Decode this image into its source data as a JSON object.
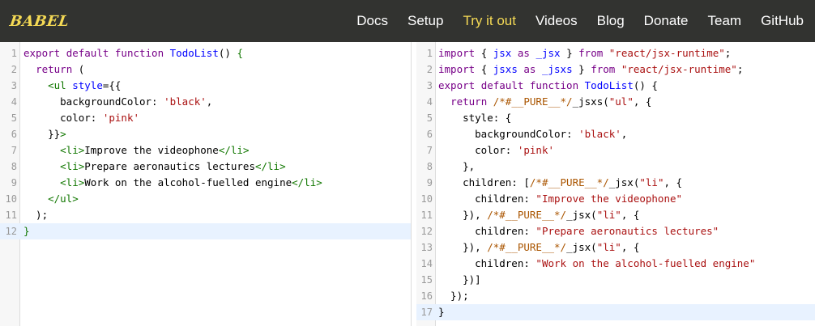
{
  "nav": {
    "logo": "BABEL",
    "links": [
      "Docs",
      "Setup",
      "Try it out",
      "Videos",
      "Blog",
      "Donate",
      "Team",
      "GitHub"
    ],
    "active": "Try it out"
  },
  "input_editor": {
    "lines": [
      [
        [
          "k",
          "export "
        ],
        [
          "k",
          "default "
        ],
        [
          "k",
          "function "
        ],
        [
          "f",
          "TodoList"
        ],
        [
          "pl",
          "() "
        ],
        [
          "t",
          "{"
        ]
      ],
      [
        [
          "pl",
          "  "
        ],
        [
          "k",
          "return "
        ],
        [
          "pl",
          "("
        ]
      ],
      [
        [
          "pl",
          "    "
        ],
        [
          "t",
          "<ul "
        ],
        [
          "f",
          "style"
        ],
        [
          "pl",
          "={{"
        ]
      ],
      [
        [
          "pl",
          "      backgroundColor: "
        ],
        [
          "s",
          "'black'"
        ],
        [
          "pl",
          ","
        ]
      ],
      [
        [
          "pl",
          "      color: "
        ],
        [
          "s",
          "'pink'"
        ]
      ],
      [
        [
          "pl",
          "    }}"
        ],
        [
          "t",
          ">"
        ]
      ],
      [
        [
          "pl",
          "      "
        ],
        [
          "t",
          "<li>"
        ],
        [
          "pl",
          "Improve the videophone"
        ],
        [
          "t",
          "</li>"
        ]
      ],
      [
        [
          "pl",
          "      "
        ],
        [
          "t",
          "<li>"
        ],
        [
          "pl",
          "Prepare aeronautics lectures"
        ],
        [
          "t",
          "</li>"
        ]
      ],
      [
        [
          "pl",
          "      "
        ],
        [
          "t",
          "<li>"
        ],
        [
          "pl",
          "Work on the alcohol-fuelled engine"
        ],
        [
          "t",
          "</li>"
        ]
      ],
      [
        [
          "pl",
          "    "
        ],
        [
          "t",
          "</ul>"
        ]
      ],
      [
        [
          "pl",
          "  );"
        ]
      ],
      [
        [
          "t",
          "}"
        ]
      ]
    ],
    "current_line": 12
  },
  "output_editor": {
    "lines": [
      [
        [
          "k",
          "import "
        ],
        [
          "pl",
          "{ "
        ],
        [
          "f",
          "jsx "
        ],
        [
          "k",
          "as "
        ],
        [
          "f",
          "_jsx "
        ],
        [
          "pl",
          "} "
        ],
        [
          "k",
          "from "
        ],
        [
          "s",
          "\"react/jsx-runtime\""
        ],
        [
          "pl",
          ";"
        ]
      ],
      [
        [
          "k",
          "import "
        ],
        [
          "pl",
          "{ "
        ],
        [
          "f",
          "jsxs "
        ],
        [
          "k",
          "as "
        ],
        [
          "f",
          "_jsxs "
        ],
        [
          "pl",
          "} "
        ],
        [
          "k",
          "from "
        ],
        [
          "s",
          "\"react/jsx-runtime\""
        ],
        [
          "pl",
          ";"
        ]
      ],
      [
        [
          "k",
          "export "
        ],
        [
          "k",
          "default "
        ],
        [
          "k",
          "function "
        ],
        [
          "f",
          "TodoList"
        ],
        [
          "pl",
          "() {"
        ]
      ],
      [
        [
          "pl",
          "  "
        ],
        [
          "k",
          "return "
        ],
        [
          "c",
          "/*#__PURE__*/"
        ],
        [
          "pl",
          "_jsxs("
        ],
        [
          "s",
          "\"ul\""
        ],
        [
          "pl",
          ", {"
        ]
      ],
      [
        [
          "pl",
          "    style: {"
        ]
      ],
      [
        [
          "pl",
          "      backgroundColor: "
        ],
        [
          "s",
          "'black'"
        ],
        [
          "pl",
          ","
        ]
      ],
      [
        [
          "pl",
          "      color: "
        ],
        [
          "s",
          "'pink'"
        ]
      ],
      [
        [
          "pl",
          "    },"
        ]
      ],
      [
        [
          "pl",
          "    children: ["
        ],
        [
          "c",
          "/*#__PURE__*/"
        ],
        [
          "pl",
          "_jsx("
        ],
        [
          "s",
          "\"li\""
        ],
        [
          "pl",
          ", {"
        ]
      ],
      [
        [
          "pl",
          "      children: "
        ],
        [
          "s",
          "\"Improve the videophone\""
        ]
      ],
      [
        [
          "pl",
          "    }), "
        ],
        [
          "c",
          "/*#__PURE__*/"
        ],
        [
          "pl",
          "_jsx("
        ],
        [
          "s",
          "\"li\""
        ],
        [
          "pl",
          ", {"
        ]
      ],
      [
        [
          "pl",
          "      children: "
        ],
        [
          "s",
          "\"Prepare aeronautics lectures\""
        ]
      ],
      [
        [
          "pl",
          "    }), "
        ],
        [
          "c",
          "/*#__PURE__*/"
        ],
        [
          "pl",
          "_jsx("
        ],
        [
          "s",
          "\"li\""
        ],
        [
          "pl",
          ", {"
        ]
      ],
      [
        [
          "pl",
          "      children: "
        ],
        [
          "s",
          "\"Work on the alcohol-fuelled engine\""
        ]
      ],
      [
        [
          "pl",
          "    })]"
        ]
      ],
      [
        [
          "pl",
          "  });"
        ]
      ],
      [
        [
          "pl",
          "}"
        ]
      ]
    ],
    "current_line": 17
  },
  "colors": {
    "navbar_bg": "#323330",
    "accent": "#f5da55",
    "keyword": "#770088",
    "string": "#aa1111",
    "tag": "#117700",
    "comment": "#aa5500",
    "current_line_bg": "#e8f2ff"
  }
}
